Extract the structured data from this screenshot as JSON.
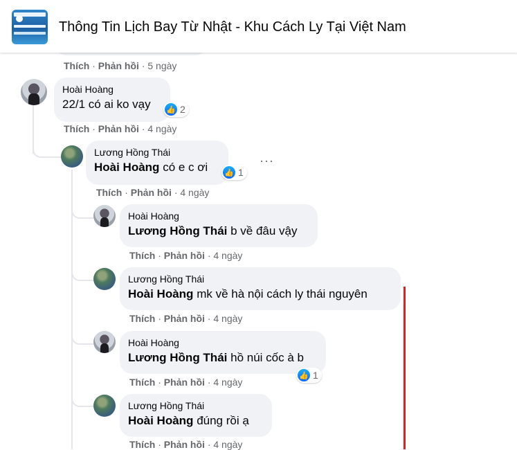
{
  "header": {
    "group_title": "Thông Tin Lịch Bay Từ Nhật - Khu Cách Ly Tại Việt Nam"
  },
  "action_labels": {
    "like": "Thích",
    "reply": "Phản hồi",
    "sep": "·"
  },
  "first_comment_actions": {
    "time": "5 ngày"
  },
  "comments": [
    {
      "author": "Hoài Hoàng",
      "mention": "",
      "text": "22/1 có ai ko vạy",
      "reactions": "2",
      "time": "4 ngày"
    },
    {
      "author": "Lương Hồng Thái",
      "mention": "Hoài Hoàng",
      "text": "có e c ơi",
      "reactions": "1",
      "time": "4 ngày",
      "menu": "···"
    },
    {
      "author": "Hoài Hoàng",
      "mention": "Lương Hồng Thái",
      "text": "b về đâu vậy",
      "time": "4 ngày"
    },
    {
      "author": "Lương Hồng Thái",
      "mention": "Hoài Hoàng",
      "text": "mk về hà nội cách ly thái nguyên",
      "time": "4 ngày"
    },
    {
      "author": "Hoài Hoàng",
      "mention": "Lương Hồng Thái",
      "text": "hồ núi cốc à b",
      "reactions": "1",
      "time": "4 ngày"
    },
    {
      "author": "Lương Hồng Thái",
      "mention": "Hoài Hoàng",
      "text": "đúng rồi ạ",
      "time": "4 ngày"
    }
  ],
  "colors": {
    "bubble": "#f0f2f5",
    "meta": "#65676b",
    "like": "#0866ff",
    "highlight_bar": "#e02020"
  },
  "icons": {
    "like": "thumbs-up-icon",
    "more": "more-options-icon"
  }
}
